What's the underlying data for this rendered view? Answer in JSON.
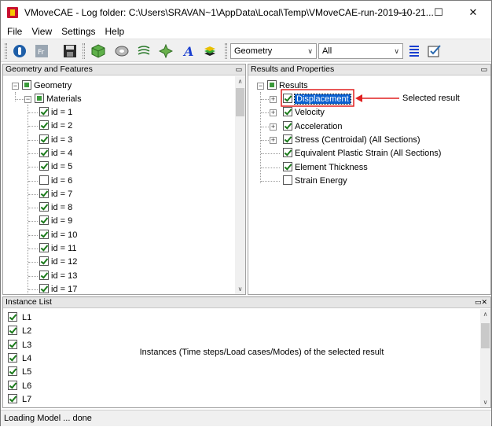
{
  "window": {
    "title": "VMoveCAE - Log folder: C:\\Users\\SRAVAN~1\\AppData\\Local\\Temp\\VMoveCAE-run-2019-10-21...",
    "minimize": "—",
    "maximize": "☐",
    "close": "✕"
  },
  "menu": [
    "File",
    "View",
    "Settings",
    "Help"
  ],
  "toolbar": {
    "combo1": "Geometry",
    "combo2": "All"
  },
  "geometry_pane": {
    "title": "Geometry and Features",
    "root": "Geometry",
    "materials": "Materials",
    "ids": [
      "id = 1",
      "id = 2",
      "id = 3",
      "id = 4",
      "id = 5",
      "id = 6",
      "id = 7",
      "id = 8",
      "id = 9",
      "id = 10",
      "id = 11",
      "id = 12",
      "id = 13",
      "id = 17"
    ],
    "checked": [
      true,
      true,
      true,
      true,
      true,
      false,
      true,
      true,
      true,
      true,
      true,
      true,
      true,
      true
    ]
  },
  "results_pane": {
    "title": "Results and Properties",
    "root": "Results",
    "items": [
      "Displacement",
      "Velocity",
      "Acceleration",
      "Stress (Centroidal) (All Sections)",
      "Equivalent Plastic Strain (All Sections)",
      "Element Thickness",
      "Strain Energy"
    ],
    "checked": [
      true,
      true,
      true,
      true,
      true,
      true,
      false
    ]
  },
  "annotation_selected": "Selected result",
  "instance_pane": {
    "title": "Instance List",
    "items": [
      "L1",
      "L2",
      "L3",
      "L4",
      "L5",
      "L6",
      "L7"
    ]
  },
  "annotation_instances": "Instances (Time steps/Load cases/Modes) of the selected result",
  "status": "Loading Model ... done",
  "colors": {
    "selection": "#0a60d0",
    "callout": "#e02020",
    "toolbar": "#f0f0f0"
  }
}
